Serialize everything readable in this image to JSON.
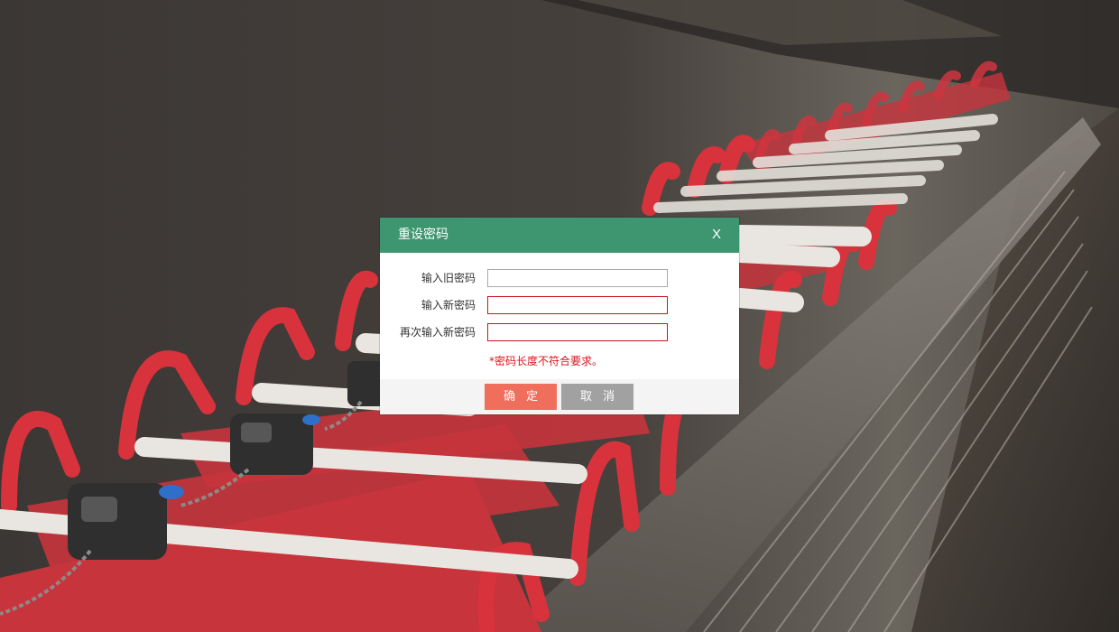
{
  "colors": {
    "header": "#3e9670",
    "confirm_button": "#ef6f5c",
    "cancel_button": "#a1a1a1",
    "error_text": "#e0121c",
    "error_border": "#c8161d"
  },
  "background": {
    "description_icon": "shopping-carts-photo"
  },
  "dialog": {
    "title": "重设密码",
    "close_label": "X",
    "fields": {
      "old_password": {
        "label": "输入旧密码",
        "value": "",
        "state": "normal"
      },
      "new_password": {
        "label": "输入新密码",
        "value": "",
        "state": "error"
      },
      "confirm_password": {
        "label": "再次输入新密码",
        "value": "",
        "state": "error"
      }
    },
    "error_message": "*密码长度不符合要求。",
    "buttons": {
      "confirm": "确定",
      "cancel": "取消"
    }
  }
}
